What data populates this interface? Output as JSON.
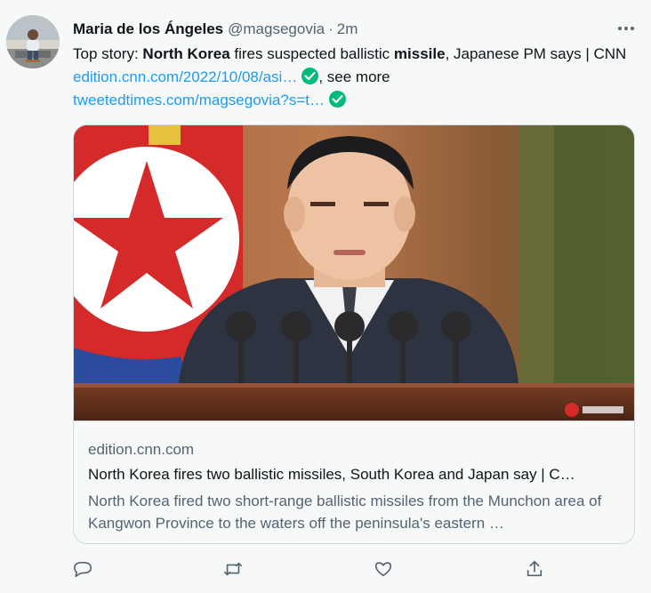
{
  "tweet": {
    "author_name": "Maria de los Ángeles",
    "author_handle": "@magsegovia",
    "separator": "·",
    "time": "2m",
    "text": {
      "prefix": "Top story: ",
      "bold1": "North Korea",
      "mid1": " fires suspected ballistic ",
      "bold2": "missile",
      "mid2": ", Japanese PM says | CNN ",
      "link1": "edition.cnn.com/2022/10/08/asi…",
      "see_more": ", see more",
      "link2": "tweetedtimes.com/magsegovia?s=t…"
    }
  },
  "card": {
    "domain": "edition.cnn.com",
    "title": "North Korea fires two ballistic missiles, South Korea and Japan say | C…",
    "description": "North Korea fired two short-range ballistic missiles from the Munchon area of Kangwon Province to the waters off the peninsula's eastern …"
  },
  "icons": [
    "more-icon",
    "verified-check-icon",
    "reply-icon",
    "retweet-icon",
    "like-icon",
    "share-icon"
  ],
  "colors": {
    "background": "#f7f9f9",
    "link": "#1d9bf0",
    "secondary_text": "#536471",
    "verified": "#00ba7c",
    "border": "#cfd9de"
  }
}
